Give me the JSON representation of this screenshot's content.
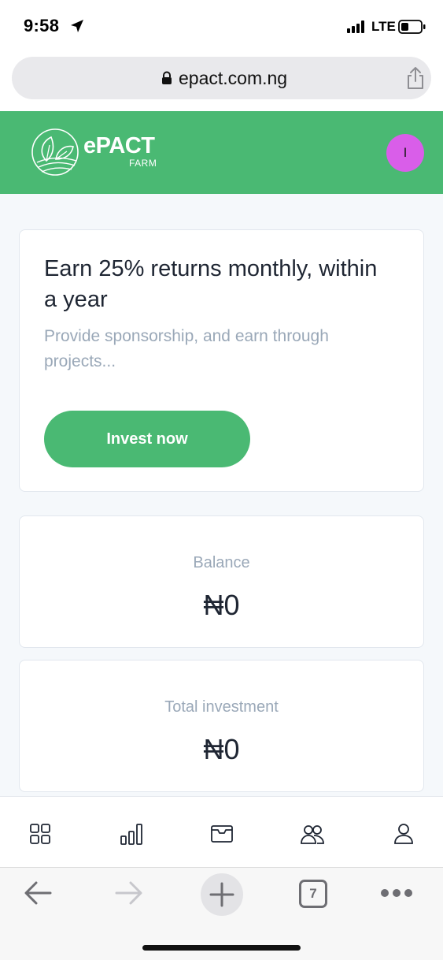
{
  "status_bar": {
    "time": "9:58",
    "network": "LTE",
    "icons": [
      "location-arrow-icon",
      "cell-signal-icon",
      "battery-icon"
    ]
  },
  "browser": {
    "url": "epact.com.ng",
    "icons": [
      "lock-icon",
      "share-icon"
    ]
  },
  "header": {
    "logo_text": "ePACT",
    "logo_sub": "FARM",
    "avatar_initial": "I",
    "colors": {
      "brand": "#4ab973",
      "avatar": "#d95ee9"
    }
  },
  "promo": {
    "title": "Earn 25% returns monthly, within a year",
    "subtitle": "Provide sponsorship, and earn through projects...",
    "button_label": "Invest now"
  },
  "balance": {
    "label": "Balance",
    "value": "₦0"
  },
  "investment": {
    "label": "Total investment",
    "value": "₦0"
  },
  "bottom_nav": {
    "items": [
      "dashboard-icon",
      "analytics-icon",
      "wallet-icon",
      "team-icon",
      "profile-icon"
    ]
  },
  "safari_toolbar": {
    "tab_count": "7",
    "icons": [
      "back-arrow-icon",
      "forward-arrow-icon",
      "new-tab-plus-icon",
      "tabs-icon",
      "more-icon"
    ]
  }
}
